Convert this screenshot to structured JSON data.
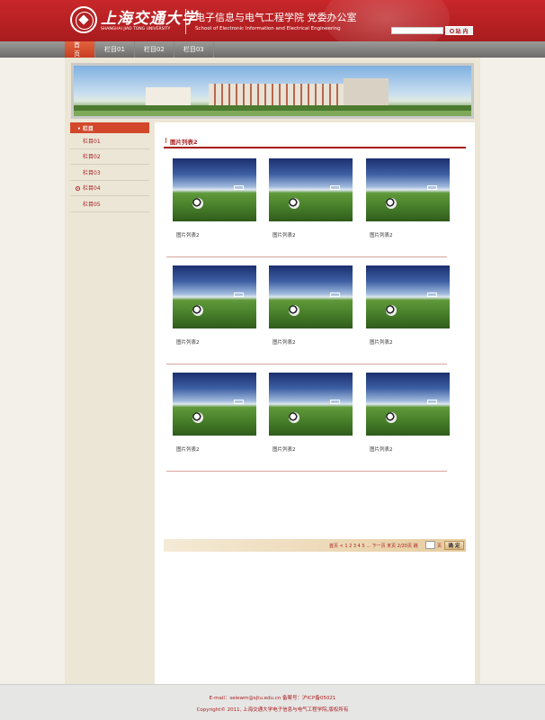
{
  "header": {
    "university_cn": "上海交通大学",
    "university_en": "SHANGHAI JIAO TONG UNIVERSITY",
    "school_cn": "电子信息与电气工程学院  党委办公室",
    "school_en": "School of Electronic Information and Electrical Engineering",
    "search_button": "站 内"
  },
  "nav": {
    "items": [
      "首 页",
      "栏目01",
      "栏目02",
      "栏目03"
    ],
    "active_index": 0
  },
  "sidebar": {
    "heading": "• 栏目",
    "items": [
      "栏目01",
      "栏目02",
      "栏目03",
      "栏目04",
      "栏目05"
    ],
    "active_index": 3
  },
  "main": {
    "title": "图片列表2",
    "rows": [
      [
        "图片列表2",
        "图片列表2",
        "图片列表2"
      ],
      [
        "图片列表2",
        "图片列表2",
        "图片列表2"
      ],
      [
        "图片列表2",
        "图片列表2",
        "图片列表2"
      ]
    ]
  },
  "pagination": {
    "text": "首页 < 1 2 3 4 5 ... 下一页 末页  2/20页 跳",
    "unit": "页",
    "go_button": "确 定"
  },
  "footer": {
    "line1": "E-mail：seiewm@sjtu.edu.cn  备案号：沪ICP备05021",
    "line2": "Copyright© 2011, 上海交通大学电子信息与电气工程学院,版权所有"
  },
  "colors": {
    "brand_red": "#a91c1e",
    "accent_orange": "#d3482b",
    "background": "#f3f0e9"
  }
}
